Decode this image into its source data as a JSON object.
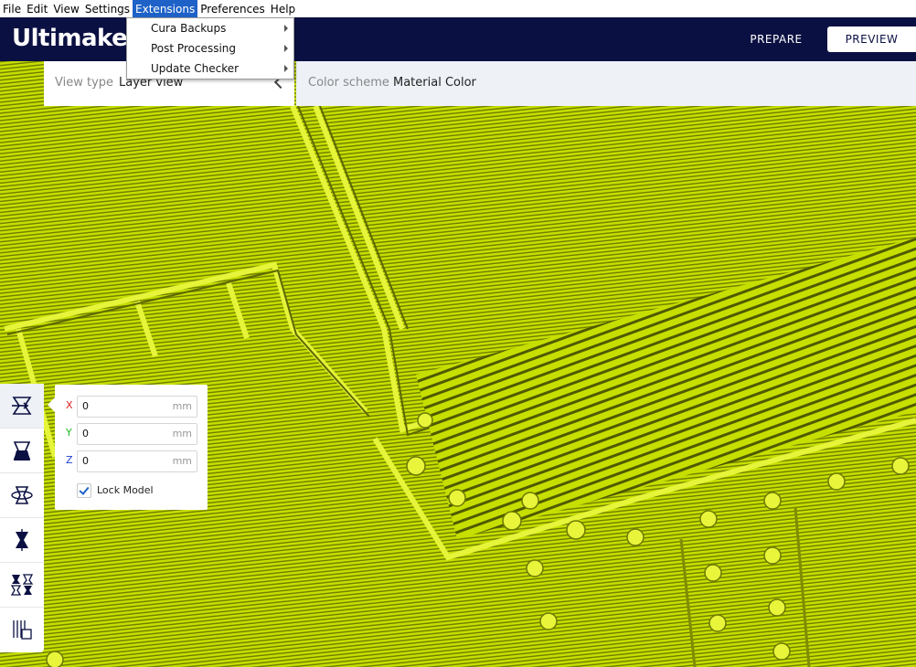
{
  "menu": [
    {
      "label": "File"
    },
    {
      "label": "Edit"
    },
    {
      "label": "View"
    },
    {
      "label": "Settings"
    },
    {
      "label": "Extensions",
      "active": true
    },
    {
      "label": "Preferences"
    },
    {
      "label": "Help"
    }
  ],
  "extensions_menu": [
    {
      "label": "Cura Backups"
    },
    {
      "label": "Post Processing"
    },
    {
      "label": "Update Checker"
    }
  ],
  "header": {
    "logo": "Ultimaker",
    "stages": {
      "prepare": "PREPARE",
      "preview": "PREVIEW"
    }
  },
  "viewbar": {
    "view_type_label": "View type",
    "view_type_value": "Layer view",
    "color_scheme_label": "Color scheme",
    "color_scheme_value": "Material Color"
  },
  "tools": [
    {
      "name": "move-tool-icon",
      "active": true
    },
    {
      "name": "scale-tool-icon"
    },
    {
      "name": "rotate-tool-icon"
    },
    {
      "name": "mirror-tool-icon"
    },
    {
      "name": "per-model-settings-icon"
    },
    {
      "name": "support-blocker-icon"
    }
  ],
  "move_panel": {
    "x": {
      "axis": "X",
      "value": "0",
      "unit": "mm",
      "color": "#e02020"
    },
    "y": {
      "axis": "Y",
      "value": "0",
      "unit": "mm",
      "color": "#20b820"
    },
    "z": {
      "axis": "Z",
      "value": "0",
      "unit": "mm",
      "color": "#2040d0"
    },
    "lock_label": "Lock Model",
    "lock_checked": true
  },
  "colors": {
    "header": "#0b1042",
    "accent": "#1e62c8",
    "model": "#c8e000"
  }
}
